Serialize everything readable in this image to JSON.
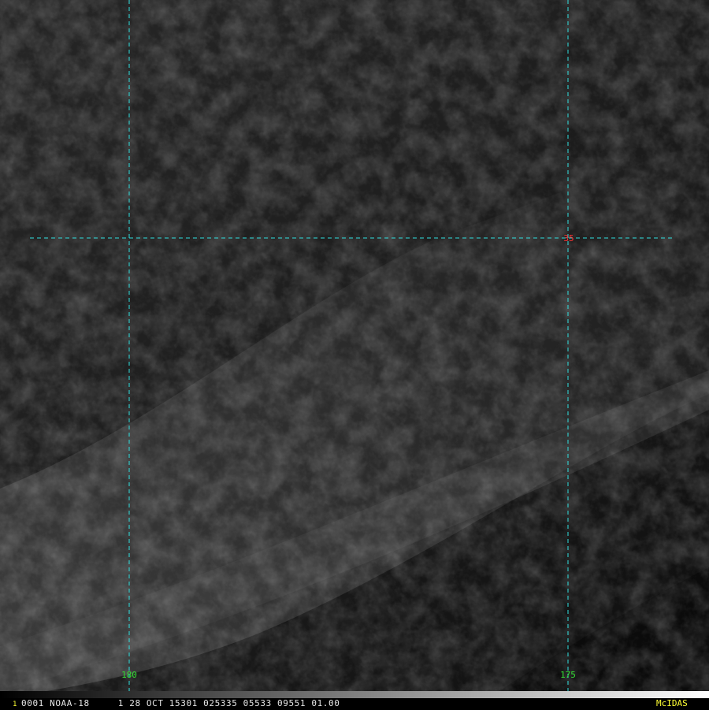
{
  "colors": {
    "grid_line": "#2fe0e0",
    "lon_label": "#33dd33",
    "lat_label": "#ff3333",
    "status_text": "#e6e6e6",
    "brand": "#ffff33"
  },
  "grid": {
    "longitudes": [
      {
        "label": "180"
      },
      {
        "label": "175"
      }
    ],
    "latitudes": [
      {
        "label": "35"
      }
    ]
  },
  "status": {
    "frame": "1",
    "text": "0001 NOAA-18     1 28 OCT 15301 025335 05533 09551 01.00",
    "brand": "McIDAS"
  },
  "colorbar": {
    "from": "#000000",
    "to": "#ffffff"
  }
}
